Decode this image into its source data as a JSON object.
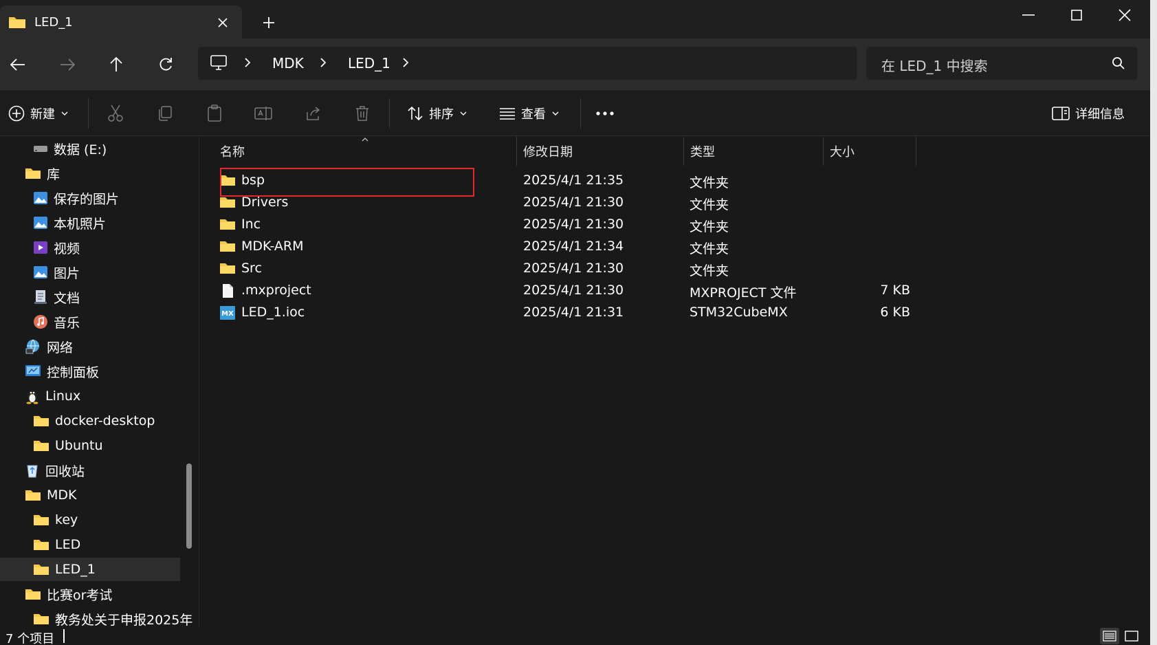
{
  "window": {
    "tab_title": "LED_1",
    "new_tab_icon": "plus-icon",
    "controls": [
      "minimize-icon",
      "maximize-icon",
      "close-icon"
    ]
  },
  "nav": {
    "back_icon": "arrow-left-icon",
    "forward_icon": "arrow-right-icon",
    "up_icon": "arrow-up-icon",
    "refresh_icon": "refresh-icon",
    "breadcrumb": [
      "MDK",
      "LED_1"
    ],
    "search_placeholder": "在 LED_1 中搜索"
  },
  "toolbar": {
    "new_label": "新建",
    "sort_label": "排序",
    "view_label": "查看",
    "more_label": "···",
    "details_label": "详细信息"
  },
  "sidebar": {
    "items": [
      {
        "label": "数据 (E:)",
        "icon": "drive-icon"
      },
      {
        "label": "库",
        "icon": "folder-icon"
      },
      {
        "label": "保存的图片",
        "icon": "pictures-icon"
      },
      {
        "label": "本机照片",
        "icon": "pictures-icon"
      },
      {
        "label": "视频",
        "icon": "video-icon"
      },
      {
        "label": "图片",
        "icon": "pictures-icon"
      },
      {
        "label": "文档",
        "icon": "document-icon"
      },
      {
        "label": "音乐",
        "icon": "music-icon"
      },
      {
        "label": "网络",
        "icon": "network-icon"
      },
      {
        "label": "控制面板",
        "icon": "control-panel-icon"
      },
      {
        "label": "Linux",
        "icon": "linux-icon"
      },
      {
        "label": "docker-desktop",
        "icon": "folder-icon"
      },
      {
        "label": "Ubuntu",
        "icon": "folder-icon"
      },
      {
        "label": "回收站",
        "icon": "recycle-bin-icon"
      },
      {
        "label": "MDK",
        "icon": "folder-icon"
      },
      {
        "label": "key",
        "icon": "folder-icon"
      },
      {
        "label": "LED",
        "icon": "folder-icon"
      },
      {
        "label": "LED_1",
        "icon": "folder-icon",
        "selected": true
      },
      {
        "label": "比赛or考试",
        "icon": "folder-icon"
      },
      {
        "label": "教务处关于申报2025年",
        "icon": "folder-icon"
      }
    ]
  },
  "columns": {
    "name": "名称",
    "modified": "修改日期",
    "type": "类型",
    "size": "大小"
  },
  "files": [
    {
      "name": "bsp",
      "modified": "2025/4/1 21:35",
      "type": "文件夹",
      "size": "",
      "icon": "folder-icon"
    },
    {
      "name": "Drivers",
      "modified": "2025/4/1 21:30",
      "type": "文件夹",
      "size": "",
      "icon": "folder-icon"
    },
    {
      "name": "Inc",
      "modified": "2025/4/1 21:30",
      "type": "文件夹",
      "size": "",
      "icon": "folder-icon"
    },
    {
      "name": "MDK-ARM",
      "modified": "2025/4/1 21:34",
      "type": "文件夹",
      "size": "",
      "icon": "folder-icon"
    },
    {
      "name": "Src",
      "modified": "2025/4/1 21:30",
      "type": "文件夹",
      "size": "",
      "icon": "folder-icon"
    },
    {
      "name": ".mxproject",
      "modified": "2025/4/1 21:30",
      "type": "MXPROJECT 文件",
      "size": "7 KB",
      "icon": "file-icon"
    },
    {
      "name": "LED_1.ioc",
      "modified": "2025/4/1 21:31",
      "type": "STM32CubeMX",
      "size": "6 KB",
      "icon": "mx-icon"
    }
  ],
  "status": {
    "count_text": "7 个项目"
  },
  "colors": {
    "accent_folder": "#f7c948",
    "highlight_box": "#e0282e",
    "mx_badge": "#3a9bd9"
  }
}
